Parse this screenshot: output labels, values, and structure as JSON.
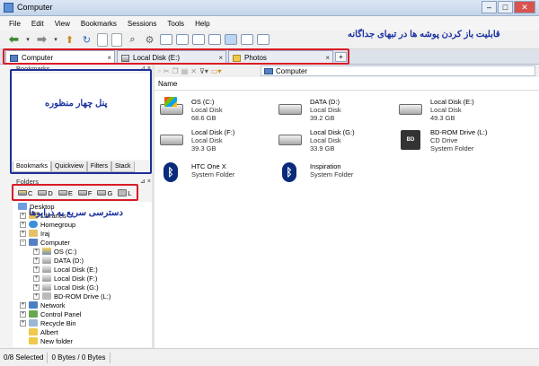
{
  "window": {
    "title": "Computer",
    "minimize": "–",
    "maximize": "□",
    "close": "✕"
  },
  "menu": [
    "File",
    "Edit",
    "View",
    "Bookmarks",
    "Sessions",
    "Tools",
    "Help"
  ],
  "annotations": {
    "tabs": "قابلیت باز کردن پوشه ها در تبهای جداگانه",
    "bookmarks": "پنل چهار منظوره",
    "drives": "دسترسی سریع به درایوها"
  },
  "tabs": [
    {
      "label": "Computer",
      "close": "×"
    },
    {
      "label": "Local Disk (E:)",
      "close": "×"
    },
    {
      "label": "Photos",
      "close": "×"
    }
  ],
  "bookmarks_pane": {
    "title": "Bookmarks",
    "pin": "⊿ ×",
    "tabs": [
      "Bookmarks",
      "Quickview",
      "Filters",
      "Stack"
    ]
  },
  "folders_pane": {
    "title": "Folders",
    "pin": "⊿ ×",
    "drives": [
      "C",
      "D",
      "E",
      "F",
      "G",
      "L"
    ]
  },
  "tree": [
    {
      "label": "Desktop",
      "exp": ""
    },
    {
      "label": "Libraries",
      "exp": "+"
    },
    {
      "label": "Homegroup",
      "exp": "+"
    },
    {
      "label": "Iraj",
      "exp": "+"
    },
    {
      "label": "Computer",
      "exp": "−"
    },
    {
      "label": "OS (C:)",
      "exp": "+"
    },
    {
      "label": "DATA (D:)",
      "exp": "+"
    },
    {
      "label": "Local Disk (E:)",
      "exp": "+"
    },
    {
      "label": "Local Disk (F:)",
      "exp": "+"
    },
    {
      "label": "Local Disk (G:)",
      "exp": "+"
    },
    {
      "label": "BD-ROM Drive (L:)",
      "exp": "+"
    },
    {
      "label": "Network",
      "exp": "+"
    },
    {
      "label": "Control Panel",
      "exp": "+"
    },
    {
      "label": "Recycle Bin",
      "exp": "+"
    },
    {
      "label": "Albert",
      "exp": ""
    },
    {
      "label": "New folder",
      "exp": ""
    }
  ],
  "address": "Computer",
  "column_header": "Name",
  "files": [
    {
      "name": "OS (C:)",
      "type": "Local Disk",
      "size": "68.6 GB",
      "icon": "system-drive-icon"
    },
    {
      "name": "DATA (D:)",
      "type": "Local Disk",
      "size": "39.2 GB",
      "icon": "hard-drive-icon"
    },
    {
      "name": "Local Disk (E:)",
      "type": "Local Disk",
      "size": "49.3 GB",
      "icon": "hard-drive-icon"
    },
    {
      "name": "Local Disk (F:)",
      "type": "Local Disk",
      "size": "39.3 GB",
      "icon": "hard-drive-icon"
    },
    {
      "name": "Local Disk (G:)",
      "type": "Local Disk",
      "size": "33.9 GB",
      "icon": "hard-drive-icon"
    },
    {
      "name": "BD-ROM Drive (L:)",
      "type": "CD Drive",
      "size": "System Folder",
      "icon": "bd-rom-icon"
    },
    {
      "name": "HTC One X",
      "type": "System Folder",
      "size": "",
      "icon": "bluetooth-icon"
    },
    {
      "name": "Inspiration",
      "type": "System Folder",
      "size": "",
      "icon": "bluetooth-icon"
    }
  ],
  "status": {
    "selected": "0/8 Selected",
    "bytes": "0 Bytes / 0 Bytes"
  }
}
